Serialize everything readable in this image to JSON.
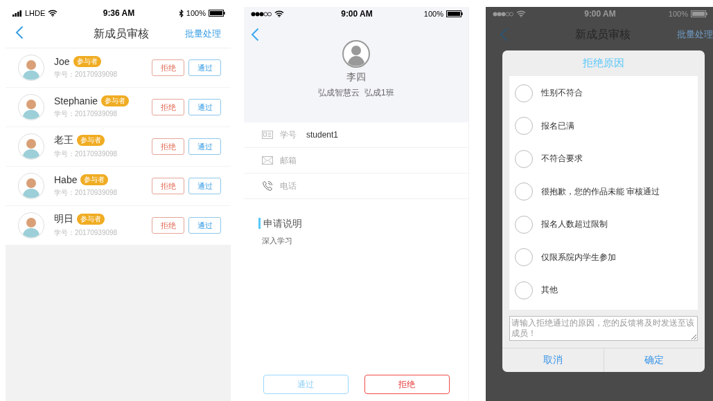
{
  "member_list_screen": {
    "status_bar": {
      "carrier": "LHDE",
      "time": "9:36 AM",
      "battery": "100%"
    },
    "title": "新成员审核",
    "action": "批量处理",
    "members": [
      {
        "name": "Joe",
        "badge": "参与者",
        "student_id": "学号：20170939098",
        "reject": "拒绝",
        "approve": "通过"
      },
      {
        "name": "Stephanie",
        "badge": "参与者",
        "student_id": "学号：20170939098",
        "reject": "拒绝",
        "approve": "通过"
      },
      {
        "name": "老王",
        "badge": "参与者",
        "student_id": "学号：20170939098",
        "reject": "拒绝",
        "approve": "通过"
      },
      {
        "name": "Habe",
        "badge": "参与者",
        "student_id": "学号：20170939098",
        "reject": "拒绝",
        "approve": "通过"
      },
      {
        "name": "明日",
        "badge": "参与者",
        "student_id": "学号：20170939098",
        "reject": "拒绝",
        "approve": "通过"
      }
    ]
  },
  "profile_screen": {
    "status_bar": {
      "time": "9:00 AM",
      "battery": "100%"
    },
    "name": "李四",
    "org": "弘成智慧云  弘成1班",
    "fields": [
      {
        "kind": "id",
        "label": "学号",
        "value": "student1"
      },
      {
        "kind": "email",
        "label": "邮箱"
      },
      {
        "kind": "phone",
        "label": "电话"
      }
    ],
    "section_title": "申请说明",
    "section_text": "深入学习",
    "buttons": [
      {
        "kind": "approve",
        "label": "通过"
      },
      {
        "kind": "reject",
        "label": "拒绝"
      }
    ]
  },
  "reject_dialog_screen": {
    "background": {
      "status_bar": {
        "time": "9:00 AM",
        "battery": "100%"
      },
      "title": "新成员审核",
      "action": "批量处理"
    },
    "dialog": {
      "title": "拒绝原因",
      "options": [
        {
          "label": "性别不符合",
          "selected": false
        },
        {
          "label": "报名已满",
          "selected": false
        },
        {
          "label": "不符合要求",
          "selected": false
        },
        {
          "label": "很抱歉，您的作品未能 审核通过",
          "selected": false
        },
        {
          "label": "报名人数超过限制",
          "selected": false
        },
        {
          "label": "仅限系院内学生参加",
          "selected": false
        },
        {
          "label": "其他",
          "selected": false
        }
      ],
      "placeholder": "请输入拒绝通过的原因，您的反馈将及时发送至该成员！",
      "buttons": [
        "取消",
        "确定"
      ]
    }
  }
}
